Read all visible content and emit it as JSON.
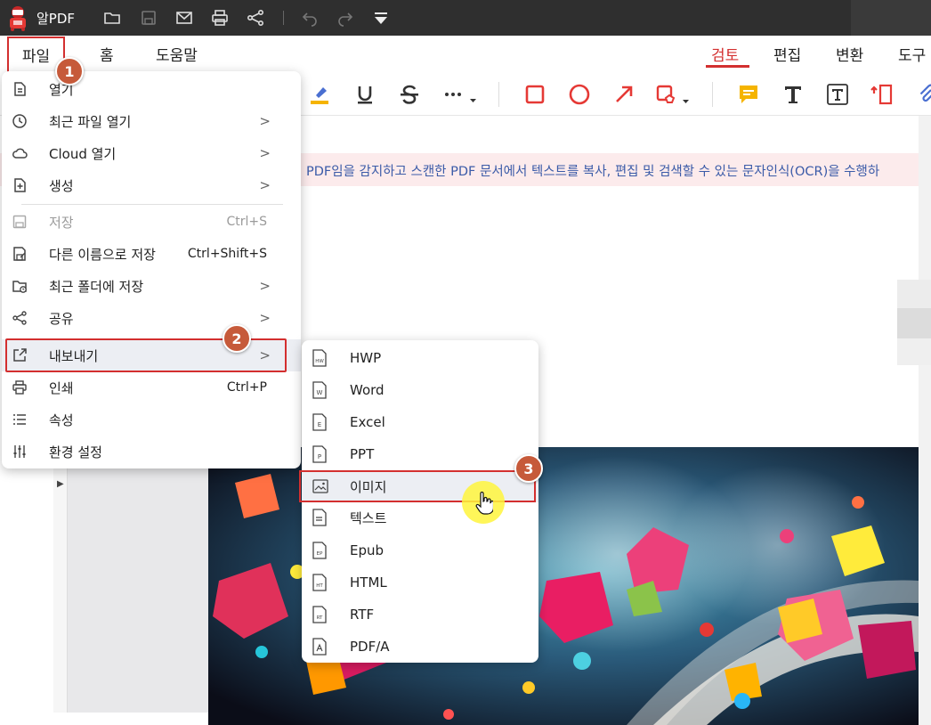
{
  "app": {
    "name": "알PDF"
  },
  "menu_tabs": {
    "file": "파일",
    "home": "홈",
    "help": "도움말"
  },
  "ribbon_tabs": [
    "검토",
    "편집",
    "변환",
    "도구"
  ],
  "ocr_banner": {
    "text": "PDF임을 감지하고 스캔한 PDF 문서에서 텍스트를 복사, 편집 및 검색할 수 있는 문자인식(OCR)을 수행하"
  },
  "file_menu": {
    "items": [
      {
        "label": "열기",
        "shortcut": "",
        "has_submenu": false,
        "icon": "open-file-icon"
      },
      {
        "label": "최근 파일 열기",
        "shortcut": "",
        "has_submenu": true,
        "icon": "clock-icon"
      },
      {
        "label": "Cloud 열기",
        "shortcut": "",
        "has_submenu": true,
        "icon": "cloud-icon"
      },
      {
        "label": "생성",
        "shortcut": "",
        "has_submenu": true,
        "icon": "new-file-icon"
      },
      {
        "label": "저장",
        "shortcut": "Ctrl+S",
        "has_submenu": false,
        "disabled": true,
        "icon": "save-icon"
      },
      {
        "label": "다른 이름으로 저장",
        "shortcut": "Ctrl+Shift+S",
        "has_submenu": false,
        "icon": "save-as-icon"
      },
      {
        "label": "최근 폴더에 저장",
        "shortcut": "",
        "has_submenu": true,
        "icon": "folder-clock-icon"
      },
      {
        "label": "공유",
        "shortcut": "",
        "has_submenu": true,
        "icon": "share-icon"
      },
      {
        "label": "내보내기",
        "shortcut": "",
        "has_submenu": true,
        "icon": "export-icon"
      },
      {
        "label": "인쇄",
        "shortcut": "Ctrl+P",
        "has_submenu": false,
        "icon": "print-icon"
      },
      {
        "label": "속성",
        "shortcut": "",
        "has_submenu": false,
        "icon": "list-icon"
      },
      {
        "label": "환경 설정",
        "shortcut": "",
        "has_submenu": false,
        "icon": "sliders-icon"
      }
    ],
    "arrow": ">"
  },
  "export_submenu": {
    "items": [
      {
        "label": "HWP",
        "tag": "HW"
      },
      {
        "label": "Word",
        "tag": "W"
      },
      {
        "label": "Excel",
        "tag": "E"
      },
      {
        "label": "PPT",
        "tag": "P"
      },
      {
        "label": "이미지",
        "tag": "img"
      },
      {
        "label": "텍스트",
        "tag": "="
      },
      {
        "label": "Epub",
        "tag": "EP"
      },
      {
        "label": "HTML",
        "tag": "HT"
      },
      {
        "label": "RTF",
        "tag": "RT"
      },
      {
        "label": "PDF/A",
        "tag": "A"
      }
    ]
  },
  "steps": {
    "one": "1",
    "two": "2",
    "three": "3"
  },
  "colors": {
    "accent": "#d32f2f",
    "titlebar": "#2f2f2f",
    "ocr_text": "#3b5ba8",
    "annot_yellow": "#f5b400",
    "shape_red": "#e53935"
  }
}
